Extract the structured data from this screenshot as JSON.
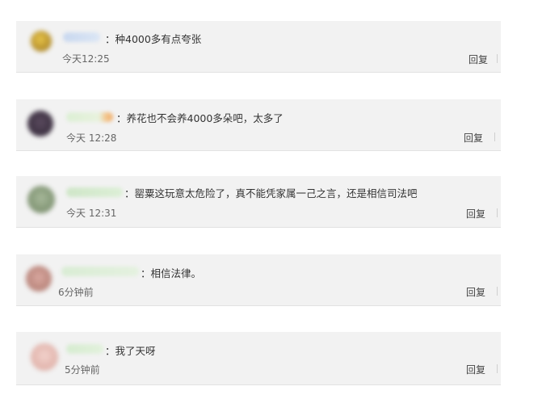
{
  "comments": [
    {
      "text": "：种4000多有点夸张",
      "time": "今天12:25",
      "reply": "回复"
    },
    {
      "text": "：养花也不会养4000多朵吧，太多了",
      "time": "今天 12:28",
      "reply": "回复"
    },
    {
      "text": "：罂粟这玩意太危险了，真不能凭家属一己之言，还是相信司法吧",
      "time": "今天 12:31",
      "reply": "回复"
    },
    {
      "text": "：相信法律。",
      "time": "6分钟前",
      "reply": "回复"
    },
    {
      "text": "：我了天呀",
      "time": "5分钟前",
      "reply": "回复"
    }
  ]
}
